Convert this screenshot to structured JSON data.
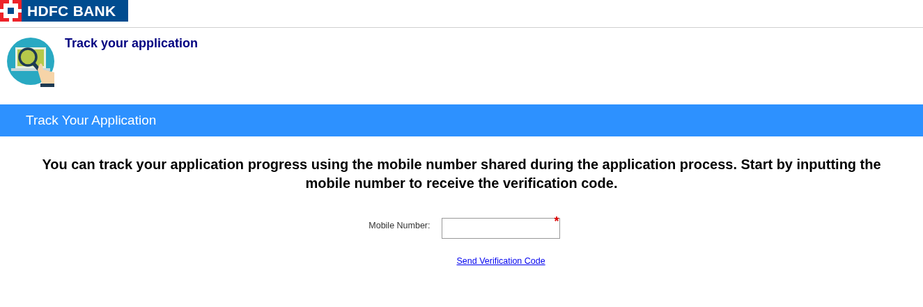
{
  "logo": {
    "text": "HDFC BANK"
  },
  "page_title": "Track your application",
  "banner": {
    "title": "Track Your Application"
  },
  "message": "You can track your application progress using the mobile number shared during the application process. Start by inputting the mobile number to receive the verification code.",
  "form": {
    "field": {
      "label": "Mobile Number:",
      "required": true,
      "required_mark": "*"
    },
    "link": "Send Verification Code"
  }
}
